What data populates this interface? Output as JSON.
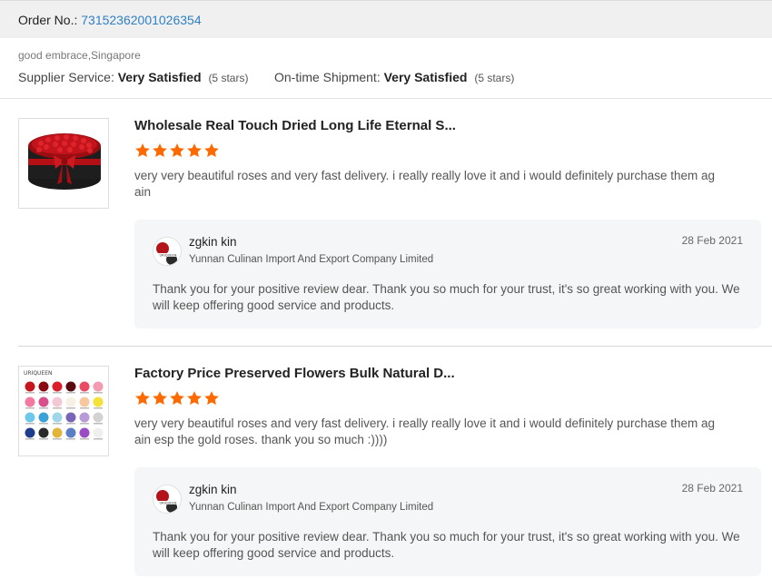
{
  "order": {
    "label": "Order No.:",
    "number": "73152362001026354"
  },
  "buyer": {
    "name_location": "good embrace,Singapore"
  },
  "ratings": {
    "supplier_label": "Supplier Service:",
    "supplier_value": "Very Satisfied",
    "supplier_stars": "(5 stars)",
    "shipment_label": "On-time Shipment:",
    "shipment_value": "Very Satisfied",
    "shipment_stars": "(5 stars)"
  },
  "colors": {
    "order_link": "#2f80c4",
    "star": "#ff6a00",
    "reply_bg": "#f5f6f7",
    "order_bar_bg": "#f0f0f0"
  },
  "reviews": [
    {
      "product_title": "Wholesale Real Touch Dried Long Life Eternal S...",
      "rating": 5,
      "comment": "very very beautiful roses and very fast delivery. i really really love it and i would definitely purchase them ag ain",
      "image_icon": "rose-box-product-image",
      "reply": {
        "name": "zgkin kin",
        "company": "Yunnan Culinan Import And Export Company Limited",
        "date": "28 Feb 2021",
        "text": "Thank you for your positive review dear. Thank you so much for your trust,  it's so great working with you. We will keep offering good service and products."
      }
    },
    {
      "product_title": "Factory Price Preserved Flowers Bulk Natural D...",
      "rating": 5,
      "comment": "very very beautiful roses and very fast delivery. i really really love it and i would definitely purchase them ag ain esp the gold roses. thank you so much :))))",
      "image_icon": "flower-color-chart-product-image",
      "image_brand": "URIQUEEN",
      "reply": {
        "name": "zgkin kin",
        "company": "Yunnan Culinan Import And Export Company Limited",
        "date": "28 Feb 2021",
        "text": "Thank you for your positive review dear. Thank you so much for your trust,  it's so great working with you. We will keep offering good service and products."
      }
    }
  ]
}
